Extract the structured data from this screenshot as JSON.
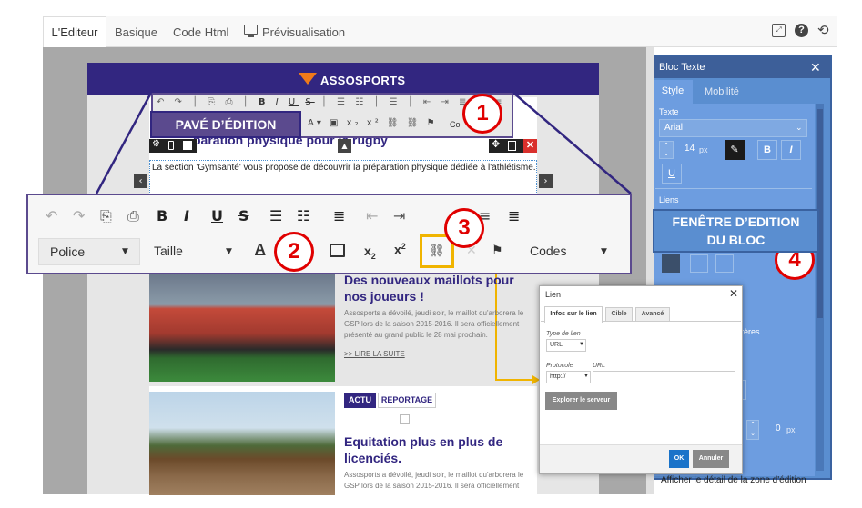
{
  "tabs": {
    "editor": "L'Editeur",
    "basic": "Basique",
    "html": "Code Html",
    "preview": "Prévisualisation"
  },
  "brand": "ASSOSPORTS",
  "callouts": {
    "pave": "PAVÉ D’ÉDITION",
    "fenetre_l1": "FENÊTRE D’EDITION",
    "fenetre_l2": "DU BLOC",
    "n1": "1",
    "n2": "2",
    "n3": "3",
    "n4": "4"
  },
  "article1": {
    "title_partial": "paration physique pour le rugby",
    "body": "La section 'Gymsanté' vous propose de découvrir la préparation physique dédiée à l'athlétisme. L'objectif est que les athlètes et les préparateurs physiques puissent exploiter des séances de",
    "title2": "Des nouveaux maillots pour nos joueurs !",
    "text2": "Assosports a dévoilé, jeudi soir, le maillot qu'arborera le GSP lors de la saison 2015-2016. Il sera officiellement présenté au grand public le 28 mai prochain.",
    "more": ">> LIRE LA SUITE"
  },
  "article2": {
    "tag1": "ACTU",
    "tag2": "REPORTAGE",
    "title": "Equitation plus en plus de licenciés.",
    "text": "Assosports a dévoilé, jeudi soir, le maillot qu'arborera le GSP lors de la saison 2015-2016. Il sera officiellement"
  },
  "toolbar": {
    "font": "Police",
    "size": "Taille",
    "codes": "Codes"
  },
  "small_toolbar": {
    "codes": "Co"
  },
  "panel": {
    "title": "Bloc Texte",
    "tab_style": "Style",
    "tab_mobile": "Mobilité",
    "sec_text": "Texte",
    "font": "Arial",
    "font_size": "14",
    "unit": "px",
    "sec_links": "Liens",
    "chars": "ctères",
    "px_val": "0",
    "unit2": "px",
    "footer": "Afficher le détail de la zone d'édition"
  },
  "dialog": {
    "title": "Lien",
    "tab1": "Infos sur le lien",
    "tab2": "Cible",
    "tab3": "Avancé",
    "type_label": "Type de lien",
    "type_val": "URL",
    "proto_label": "Protocole",
    "url_label": "URL",
    "proto_val": "http://",
    "browse": "Explorer le serveur",
    "ok": "OK",
    "cancel": "Annuler"
  },
  "colors": {
    "purple": "#322680",
    "callout": "#5b4a8e",
    "blue": "#1a73c9",
    "yellow": "#f0b400",
    "red": "#e00000"
  }
}
